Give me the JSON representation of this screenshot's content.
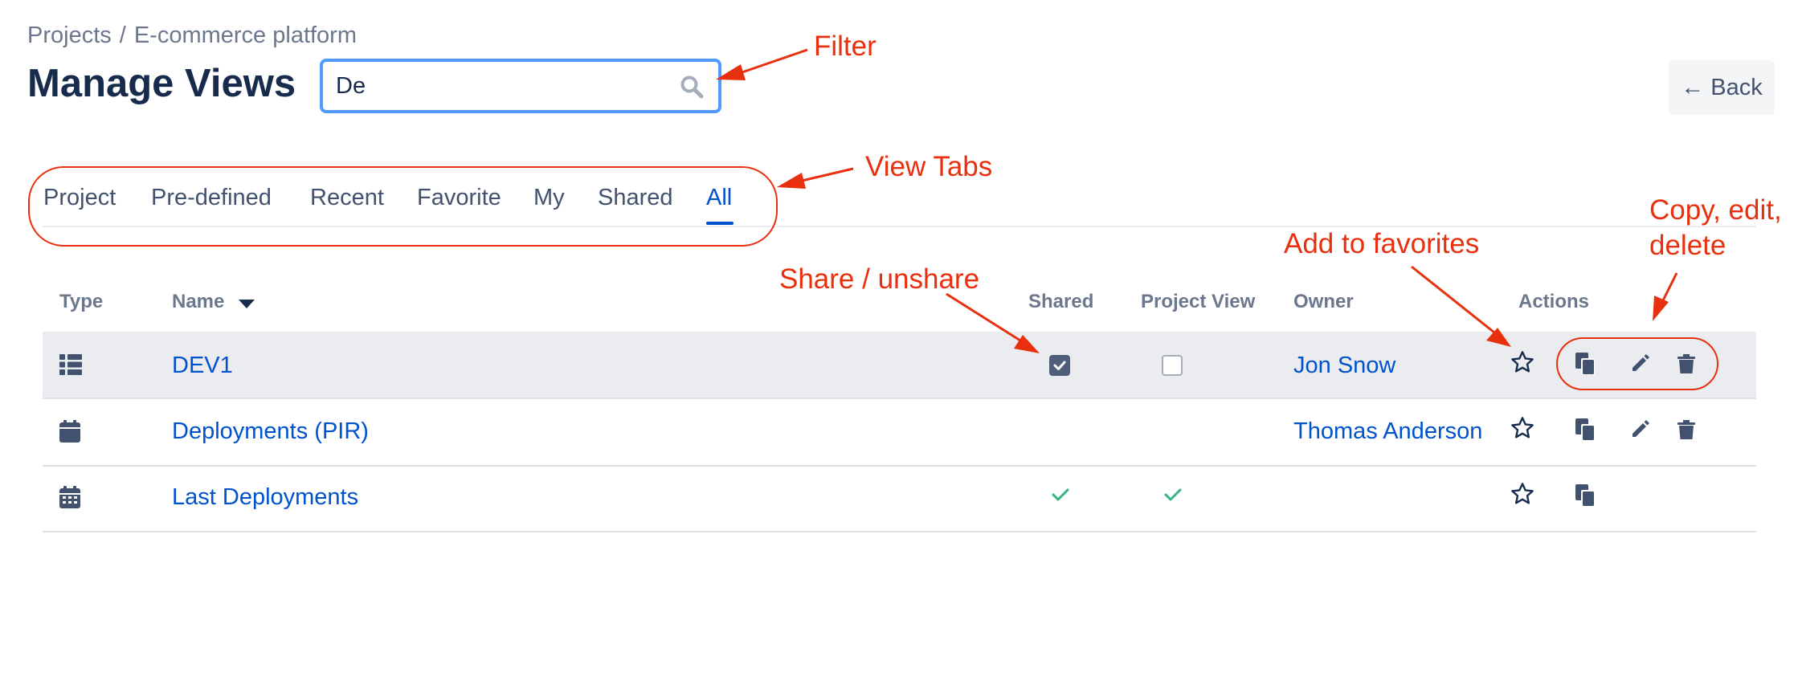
{
  "breadcrumb": {
    "project_link": "Projects",
    "separator": "/",
    "current": "E-commerce platform"
  },
  "page": {
    "title": "Manage Views",
    "back_label": "← Back"
  },
  "search": {
    "value": "De"
  },
  "tabs": [
    {
      "label": "Project",
      "active": false
    },
    {
      "label": "Pre-defined",
      "active": false
    },
    {
      "label": "Recent",
      "active": false
    },
    {
      "label": "Favorite",
      "active": false
    },
    {
      "label": "My",
      "active": false
    },
    {
      "label": "Shared",
      "active": false
    },
    {
      "label": "All",
      "active": true
    }
  ],
  "table": {
    "headers": {
      "type": "Type",
      "name": "Name",
      "shared": "Shared",
      "project_view": "Project View",
      "owner": "Owner",
      "actions": "Actions"
    },
    "rows": [
      {
        "type_icon": "list-icon",
        "name": "DEV1",
        "shared": "checkbox-checked",
        "project_view": "checkbox-unchecked",
        "owner": "Jon Snow",
        "actions": [
          "star",
          "copy",
          "edit",
          "delete"
        ]
      },
      {
        "type_icon": "calendar-icon",
        "name": "Deployments (PIR)",
        "shared": "",
        "project_view": "",
        "owner": "Thomas Anderson",
        "actions": [
          "star",
          "copy",
          "edit",
          "delete"
        ]
      },
      {
        "type_icon": "calendar-grid-icon",
        "name": "Last Deployments",
        "shared": "check",
        "project_view": "check",
        "owner": "",
        "actions": [
          "star",
          "copy"
        ]
      }
    ]
  },
  "annotations": {
    "filter": "Filter",
    "view_tabs": "View Tabs",
    "share": "Share / unshare",
    "favorites": "Add to favorites",
    "copy_line1": "Copy, edit,",
    "copy_line2": "delete"
  },
  "colors": {
    "accent": "#0052cc",
    "focus": "#4c9aff",
    "annotation": "#e8300f",
    "check": "#36b37e",
    "row_highlight": "#ebecf0"
  }
}
